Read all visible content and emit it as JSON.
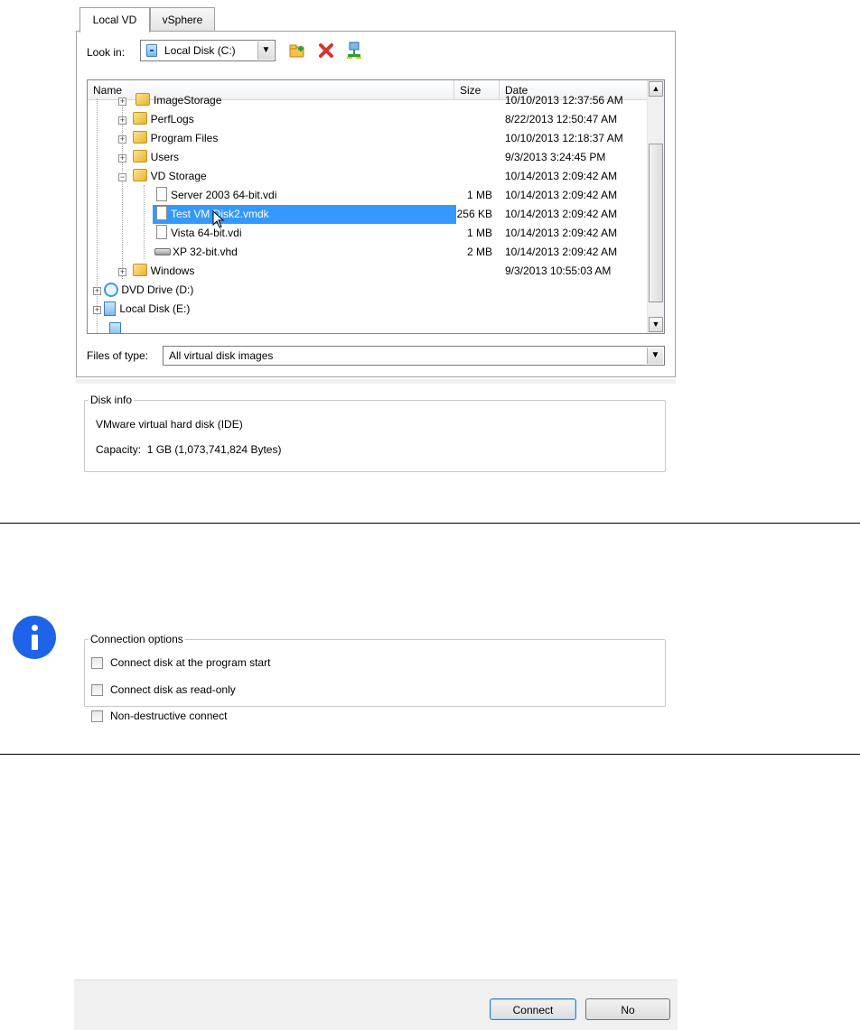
{
  "tabs": [
    "Local VD",
    "vSphere"
  ],
  "look_in": {
    "label": "Look in:",
    "value": "Local Disk (C:)"
  },
  "columns": [
    "Name",
    "Size",
    "Date"
  ],
  "rows": [
    {
      "name": "ImageStorage",
      "size": "",
      "date": "10/10/2013 12:37:56 AM"
    },
    {
      "name": "PerfLogs",
      "size": "",
      "date": "8/22/2013 12:50:47 AM"
    },
    {
      "name": "Program Files",
      "size": "",
      "date": "10/10/2013 12:18:37 AM"
    },
    {
      "name": "Users",
      "size": "",
      "date": "9/3/2013 3:24:45 PM"
    },
    {
      "name": "VD Storage",
      "size": "",
      "date": "10/14/2013 2:09:42 AM"
    },
    {
      "name": "Server 2003 64-bit.vdi",
      "size": "1 MB",
      "date": "10/14/2013 2:09:42 AM"
    },
    {
      "name": "Test VM Disk2.vmdk",
      "size": "256 KB",
      "date": "10/14/2013 2:09:42 AM"
    },
    {
      "name": "Vista 64-bit.vdi",
      "size": "1 MB",
      "date": "10/14/2013 2:09:42 AM"
    },
    {
      "name": "XP 32-bit.vhd",
      "size": "2 MB",
      "date": "10/14/2013 2:09:42 AM"
    },
    {
      "name": "Windows",
      "size": "",
      "date": "9/3/2013 10:55:03 AM"
    },
    {
      "name": "DVD Drive (D:)",
      "size": "",
      "date": ""
    },
    {
      "name": "Local Disk (E:)",
      "size": "",
      "date": ""
    }
  ],
  "files_of_type": {
    "label": "Files of type:",
    "value": "All virtual disk images"
  },
  "disk_info": {
    "legend": "Disk info",
    "line1": "VMware virtual hard disk (IDE)",
    "line2": "Capacity:  1 GB (1,073,741,824 Bytes)"
  },
  "connection_options": {
    "legend": "Connection options",
    "options": [
      {
        "label": "Connect disk at the program start",
        "checked": false
      },
      {
        "label": "Connect disk as read-only",
        "checked": false
      },
      {
        "label": "Non-destructive connect",
        "checked": false
      }
    ]
  },
  "buttons": {
    "connect": "Connect",
    "no": "No"
  },
  "icons": [
    "new-folder-icon",
    "delete-icon",
    "network-icon",
    "info-icon"
  ],
  "colors": {
    "selection": "#3399ff",
    "info": "#1f63e8"
  }
}
